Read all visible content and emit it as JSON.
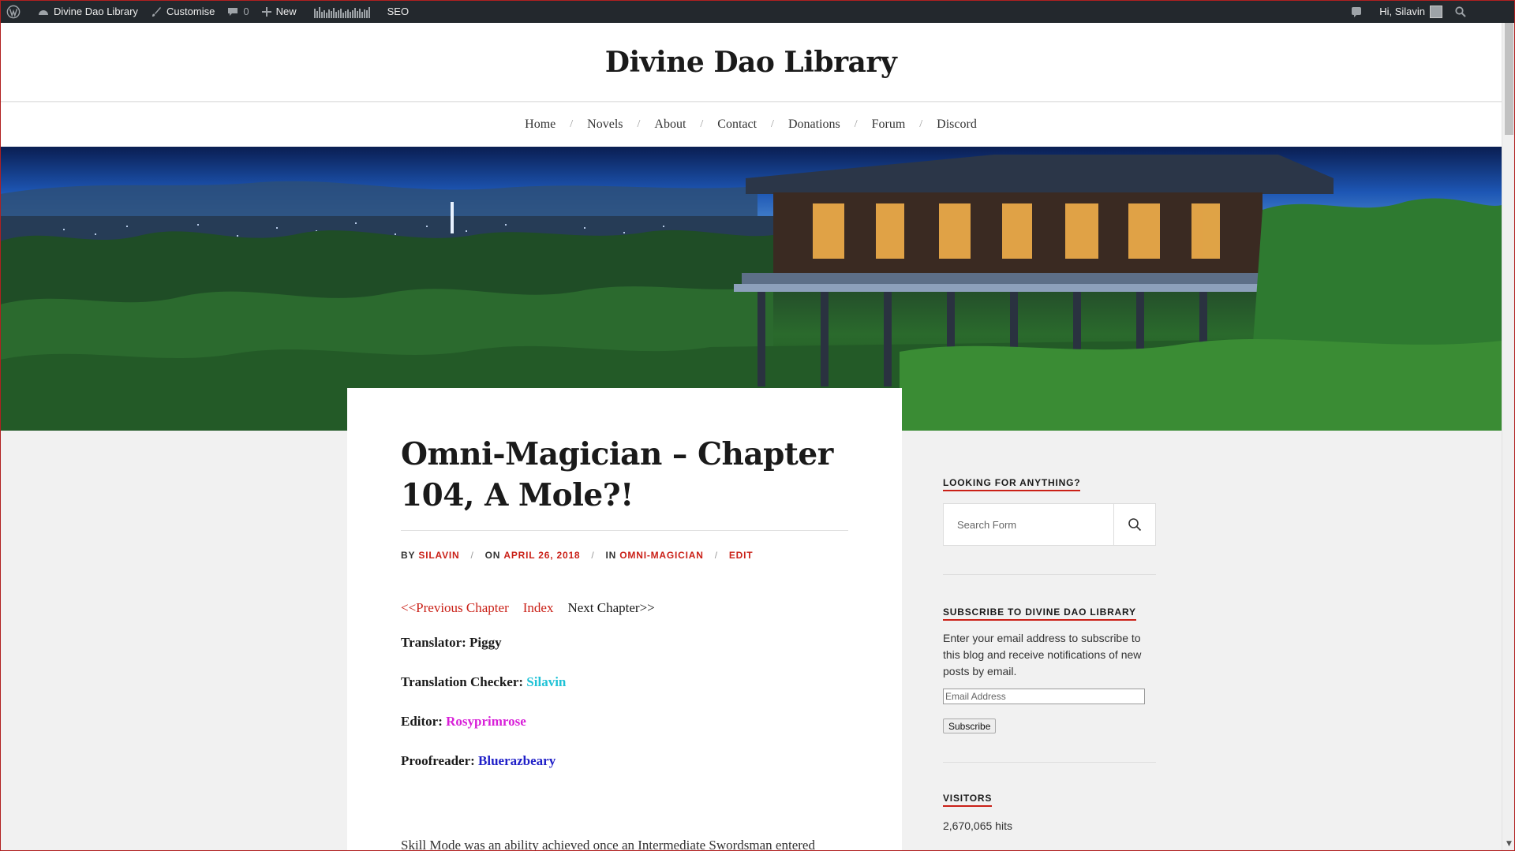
{
  "admin_bar": {
    "site_name": "Divine Dao Library",
    "customise": "Customise",
    "comments_count": "0",
    "new": "New",
    "seo": "SEO",
    "greeting": "Hi, Silavin",
    "bar_color": "#23282d"
  },
  "site": {
    "title": "Divine Dao Library",
    "accent_color": "#ca2017"
  },
  "nav": {
    "items": [
      "Home",
      "Novels",
      "About",
      "Contact",
      "Donations",
      "Forum",
      "Discord"
    ],
    "separator": "/"
  },
  "post": {
    "title": "Omni-Magician – Chapter 104, A Mole?!",
    "meta": {
      "by_label": "BY",
      "author": "SILAVIN",
      "on_label": "ON",
      "date": "APRIL 26, 2018",
      "in_label": "IN",
      "category": "OMNI-MAGICIAN",
      "edit": "EDIT"
    },
    "chapter_nav": {
      "previous": "<<Previous Chapter",
      "index": "Index",
      "next": "Next Chapter>>"
    },
    "credits": [
      {
        "label": "Translator:",
        "name": "Piggy",
        "color": "#1a1a1a"
      },
      {
        "label": "Translation Checker:",
        "name": "Silavin",
        "color": "#1fc2d6"
      },
      {
        "label": "Editor:",
        "name": "Rosyprimrose",
        "color": "#d81fd8"
      },
      {
        "label": "Proofreader:",
        "name": "Bluerazbeary",
        "color": "#2020c8"
      }
    ],
    "excerpt": "Skill Mode was an ability achieved once an Intermediate Swordsman entered"
  },
  "sidebar": {
    "search": {
      "title": "LOOKING FOR ANYTHING?",
      "placeholder": "Search Form",
      "icon": "search-icon"
    },
    "subscribe": {
      "title": "SUBSCRIBE TO DIVINE DAO LIBRARY",
      "text": "Enter your email address to subscribe to this blog and receive notifications of new posts by email.",
      "email_placeholder": "Email Address",
      "button": "Subscribe"
    },
    "visitors": {
      "title": "VISITORS",
      "hits": "2,670,065 hits"
    }
  }
}
